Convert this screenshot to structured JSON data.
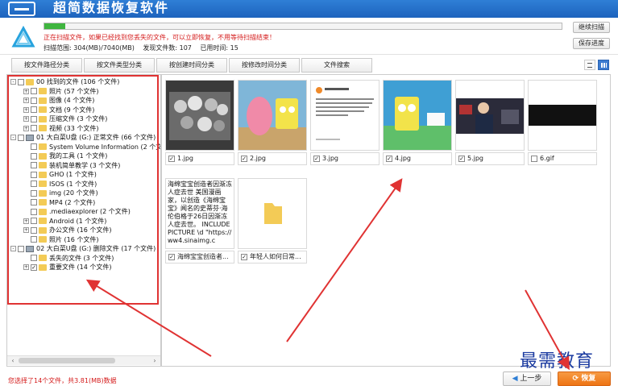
{
  "window": {
    "title": "超简数据恢复软件",
    "title_icon": "computer-icon"
  },
  "scan": {
    "progress_percent": 4,
    "warning": "正在扫描文件，如果已经找到您丢失的文件，可以立即恢复，不用等待扫描结束！",
    "range_label": "扫描范围: 304(MB)/7040(MB)",
    "found_label": "发现文件数: 107",
    "time_label": "已用时间: 15",
    "continue_label": "继续扫描",
    "save_label": "保存进度",
    "logo_icon": "recovery-logo-icon"
  },
  "tabs": [
    {
      "label": "按文件路径分类"
    },
    {
      "label": "按文件类型分类"
    },
    {
      "label": "按创建时间分类"
    },
    {
      "label": "按修改时间分类"
    },
    {
      "label": "文件搜索"
    }
  ],
  "view_icons": [
    "list-view-icon",
    "grid-view-icon"
  ],
  "tree": [
    {
      "level": 0,
      "exp": "-",
      "icon": "folder",
      "text": "00 找到的文件  (106 个文件)"
    },
    {
      "level": 1,
      "exp": "+",
      "icon": "folder",
      "text": "照片   (57 个文件)"
    },
    {
      "level": 1,
      "exp": "+",
      "icon": "folder",
      "text": "图像   (4 个文件)"
    },
    {
      "level": 1,
      "exp": "+",
      "icon": "folder",
      "text": "文档   (9 个文件)"
    },
    {
      "level": 1,
      "exp": "+",
      "icon": "folder",
      "text": "压缩文件   (3 个文件)"
    },
    {
      "level": 1,
      "exp": "+",
      "icon": "folder",
      "text": "视频   (33 个文件)"
    },
    {
      "level": 0,
      "exp": "-",
      "icon": "disk",
      "text": "01 大白菜U盘 (G:) 正常文件 (66 个文件)"
    },
    {
      "level": 1,
      "exp": "",
      "icon": "folder",
      "text": "System Volume Information   (2 个文件)"
    },
    {
      "level": 1,
      "exp": "",
      "icon": "folder",
      "text": "我的工具   (1 个文件)"
    },
    {
      "level": 1,
      "exp": "",
      "icon": "folder",
      "text": "装机简单教学   (3 个文件)"
    },
    {
      "level": 1,
      "exp": "",
      "icon": "folder",
      "text": "GHO   (1 个文件)"
    },
    {
      "level": 1,
      "exp": "",
      "icon": "folder",
      "text": "ISOS   (1 个文件)"
    },
    {
      "level": 1,
      "exp": "",
      "icon": "folder",
      "text": "img   (20 个文件)"
    },
    {
      "level": 1,
      "exp": "",
      "icon": "folder",
      "text": "MP4   (2 个文件)"
    },
    {
      "level": 1,
      "exp": "",
      "icon": "folder",
      "text": ".mediaexplorer   (2 个文件)"
    },
    {
      "level": 1,
      "exp": "+",
      "icon": "folder",
      "text": "Android   (1 个文件)"
    },
    {
      "level": 1,
      "exp": "+",
      "icon": "folder",
      "text": "办公文件   (16 个文件)"
    },
    {
      "level": 1,
      "exp": "",
      "icon": "folder",
      "text": "照片   (16 个文件)"
    },
    {
      "level": 0,
      "exp": "-",
      "icon": "disk",
      "text": "02 大白菜U盘 (G:) 删除文件 (17 个文件)"
    },
    {
      "level": 1,
      "exp": "",
      "icon": "folder",
      "text": "丢失的文件   (3 个文件)"
    },
    {
      "level": 1,
      "exp": "+",
      "icon": "folder",
      "text": "重要文件   (14 个文件)",
      "checked": true
    }
  ],
  "files": [
    {
      "name": "1.jpg",
      "thumb": "bw-figures"
    },
    {
      "name": "2.jpg",
      "thumb": "cartoon-pink"
    },
    {
      "name": "3.jpg",
      "thumb": "tweet"
    },
    {
      "name": "4.jpg",
      "thumb": "cartoon-sponge"
    },
    {
      "name": "5.jpg",
      "thumb": "people"
    },
    {
      "name": "6.gif",
      "thumb": "black-band"
    },
    {
      "name": "海绵宝宝创造者...",
      "thumb": "text",
      "preview": "海绵宝宝创造者因渐冻人症去世 美国漫画家，以创造《海绵宝宝》闻名的史蒂芬·海伦伯格于26日因渐冻人症去世。 INCLUDEPICTURE \\d \"https://ww4.sinaimg.c"
    },
    {
      "name": "年轻人如何日常...",
      "thumb": "folder"
    }
  ],
  "status_text": "您选择了14个文件，共3.81(MB)数据",
  "prev_label": "上一步",
  "recover_label": "恢复",
  "prev_icon": "arrow-left-icon",
  "recover_icon": "recover-icon",
  "watermark": "最需教育",
  "colors": {
    "title_blue": "#1d63bd",
    "warning_red": "#d41a1a",
    "progress_green": "#3fb53f",
    "annotation_red": "#e03333",
    "recover_orange": "#f07a1c"
  }
}
